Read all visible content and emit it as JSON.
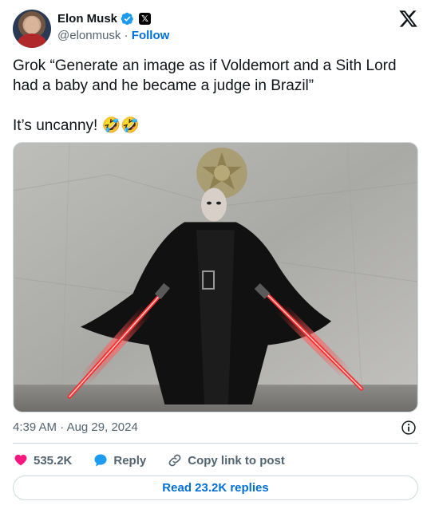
{
  "author": {
    "name": "Elon Musk",
    "handle": "@elonmusk",
    "separator": "·",
    "follow_label": "Follow",
    "platform_badge": "𝕏"
  },
  "tweet": {
    "line1": "Grok “Generate an image as if Voldemort and a Sith Lord had a baby and he became a judge in Brazil”",
    "line2": "It’s uncanny! 🤣🤣"
  },
  "meta": {
    "time": "4:39 AM",
    "separator": "·",
    "date": "Aug 29, 2024"
  },
  "actions": {
    "likes": "535.2K",
    "reply_label": "Reply",
    "copy_label": "Copy link to post"
  },
  "replies_button": "Read 23.2K replies",
  "icons": {
    "logo": "x-logo-icon",
    "verified": "verified-badge-icon",
    "info": "info-icon",
    "like": "heart-icon",
    "reply": "reply-bubble-icon",
    "copy": "link-icon"
  },
  "colors": {
    "accent": "#006fd6",
    "verified": "#1d9bf0",
    "like": "#f91880",
    "muted": "#536471",
    "saber": "#ff2a2a"
  }
}
